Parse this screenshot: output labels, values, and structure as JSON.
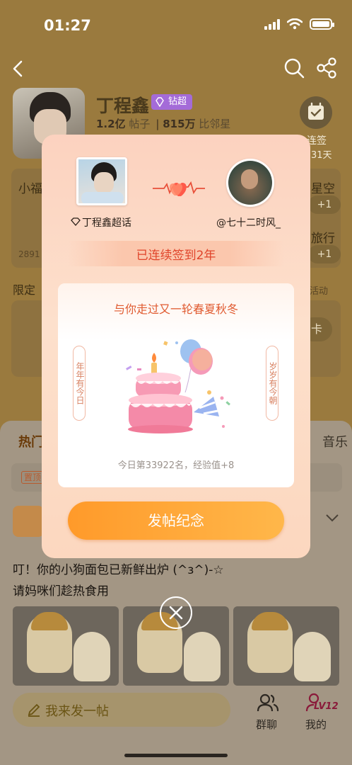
{
  "status_bar": {
    "time": "01:27"
  },
  "topic": {
    "name": "丁程鑫",
    "badge": "钻超",
    "posts_value": "1.2亿",
    "posts_label": "帖子",
    "neighbors_value": "815万",
    "neighbors_label": "比邻星",
    "checkin_label": "连签",
    "checkin_days": "31天"
  },
  "background": {
    "card1_text": "小福",
    "card1_count": "2891",
    "card2_text1": "星空",
    "card2_text2": "旅行",
    "plus_label": "+1",
    "limited_label": "限定",
    "activity_label": "活动",
    "card_btn": "卡"
  },
  "tabs": {
    "hot": "热门",
    "music": "音乐"
  },
  "pin_tag": "置顶",
  "post": {
    "line1": "叮！你的小狗面包已新鲜出炉 (^ɜ^)-☆",
    "line2": "请妈咪们趁热食用"
  },
  "bottom_nav": {
    "compose": "我来发一帖",
    "group_chat": "群聊",
    "me": "我的",
    "level": "LV12"
  },
  "modal": {
    "user_left": "丁程鑫超话",
    "user_right": "@七十二时风_",
    "streak": "已连续签到2年",
    "slogan": "与你走过又一轮春夏秋冬",
    "banner_left": "年年有今日",
    "banner_right": "岁岁有今朝",
    "rank_text": "今日第33922名，经验值+8",
    "post_button": "发帖纪念"
  },
  "colors": {
    "accent_orange": "#ff9a2a",
    "streak_red": "#e0442a",
    "badge_purple": "#a46bd8"
  },
  "icons": [
    "back-icon",
    "search-icon",
    "share-icon",
    "calendar-check-icon",
    "diamond-icon",
    "heart-ecg-icon",
    "cake-icon",
    "close-icon",
    "pencil-icon",
    "group-chat-icon",
    "user-icon",
    "chevron-down-icon"
  ]
}
